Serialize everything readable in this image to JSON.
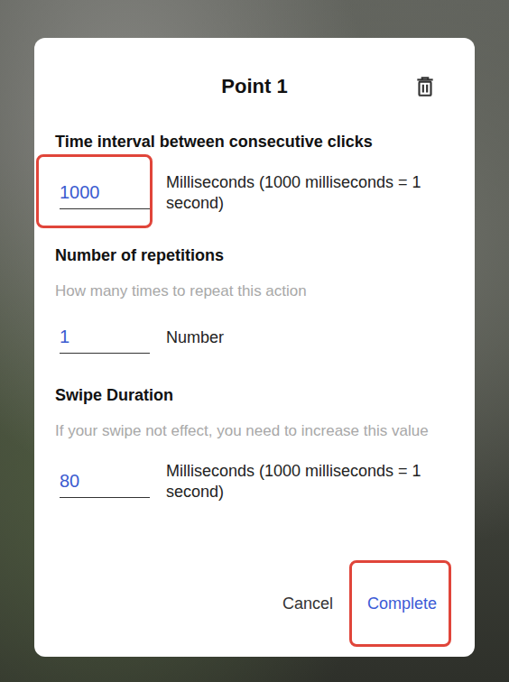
{
  "dialog": {
    "title": "Point 1"
  },
  "fields": [
    {
      "label": "Time interval between consecutive clicks",
      "value": "1000",
      "unit": "Milliseconds (1000 milliseconds = 1 second)",
      "highlighted": true
    },
    {
      "label": "Number of repetitions",
      "hint": "How many times to repeat this action",
      "value": "1",
      "unit": "Number",
      "highlighted": false
    },
    {
      "label": "Swipe Duration",
      "hint": "If your swipe not effect, you need to increase this value",
      "value": "80",
      "unit": "Milliseconds (1000 milliseconds = 1 second)",
      "highlighted": false
    }
  ],
  "buttons": [
    {
      "label": "Cancel",
      "primary": false,
      "highlighted": false
    },
    {
      "label": "Complete",
      "primary": true,
      "highlighted": true
    }
  ]
}
